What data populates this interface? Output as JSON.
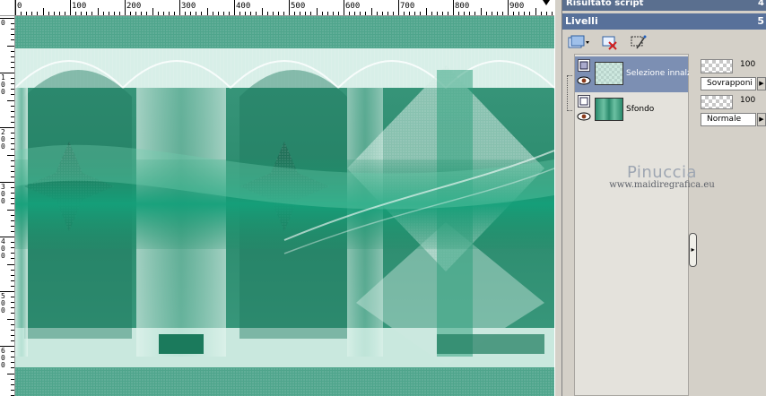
{
  "ruler": {
    "h_labels": [
      "0",
      "100",
      "200",
      "300",
      "400",
      "500",
      "600",
      "700",
      "800",
      "900"
    ],
    "v_labels": [
      "0",
      "1 0 0",
      "2 0 0",
      "3 0 0",
      "4 0 0",
      "5 0 0",
      "6 0 0"
    ]
  },
  "panels": {
    "previous_title": "Risultato script",
    "previous_number": "4",
    "layers_title": "Livelli",
    "layers_number": "5"
  },
  "toolbar": {
    "new_layer_icon": "new-raster-layer-icon",
    "delete_icon": "delete-layer-icon",
    "mask_icon": "edit-selection-icon"
  },
  "layers": [
    {
      "name": "Selezione innalzata",
      "opacity": "100",
      "blend_mode": "Sovrapponi",
      "selected": true
    },
    {
      "name": "Sfondo",
      "opacity": "100",
      "blend_mode": "Normale",
      "selected": false
    }
  ],
  "watermark": {
    "name": "Pinuccia",
    "url": "www.maidiregrafica.eu"
  },
  "colors": {
    "accent": "#58719a",
    "artwork_primary": "#2f8f70",
    "artwork_light": "#b8e0d4"
  }
}
